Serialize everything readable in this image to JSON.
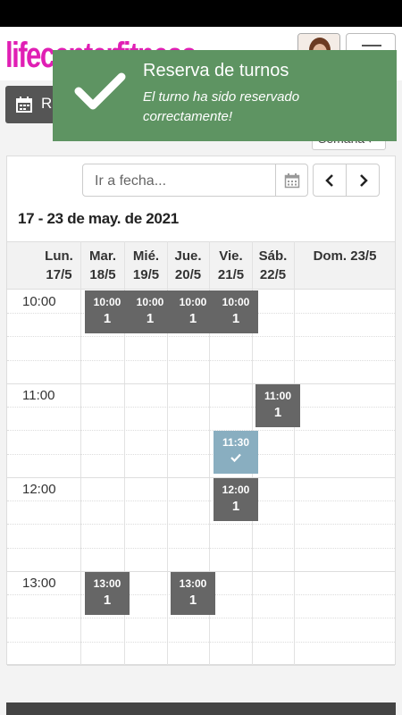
{
  "header": {
    "logo_text": "lifecenterfitness",
    "avatar_icon": "user-avatar",
    "menu_icon": "hamburger-icon"
  },
  "toolbar": {
    "reserve_label": "Re",
    "view_select_value": "Semana"
  },
  "toast": {
    "title": "Reserva de turnos",
    "message": "El turno ha sido reservado correctamente!",
    "color": "#5e9462"
  },
  "calendar": {
    "goto_placeholder": "Ir a fecha...",
    "range_title": "17 - 23 de may. de 2021",
    "days": [
      {
        "name": "Lun.",
        "date": "17/5"
      },
      {
        "name": "Mar.",
        "date": "18/5"
      },
      {
        "name": "Mié.",
        "date": "19/5"
      },
      {
        "name": "Jue.",
        "date": "20/5"
      },
      {
        "name": "Vie.",
        "date": "21/5"
      },
      {
        "name": "Sáb.",
        "date": "22/5"
      },
      {
        "name": "Dom. 23/5",
        "date": ""
      }
    ],
    "hours": [
      "10:00",
      "11:00",
      "12:00",
      "13:00"
    ],
    "slots": [
      {
        "day": "Mar.",
        "time": "10:00",
        "count": "1"
      },
      {
        "day": "Mié.",
        "time": "10:00",
        "count": "1"
      },
      {
        "day": "Jue.",
        "time": "10:00",
        "count": "1"
      },
      {
        "day": "Vie.",
        "time": "10:00",
        "count": "1"
      },
      {
        "day": "Sáb.",
        "time": "11:00",
        "count": "1"
      },
      {
        "day": "Vie.",
        "time": "11:30",
        "count": "",
        "booked": true
      },
      {
        "day": "Vie.",
        "time": "12:00",
        "count": "1"
      },
      {
        "day": "Mar.",
        "time": "13:00",
        "count": "1"
      },
      {
        "day": "Jue.",
        "time": "13:00",
        "count": "1"
      }
    ],
    "slot_color": "#666666",
    "booked_color": "#89aec0"
  }
}
